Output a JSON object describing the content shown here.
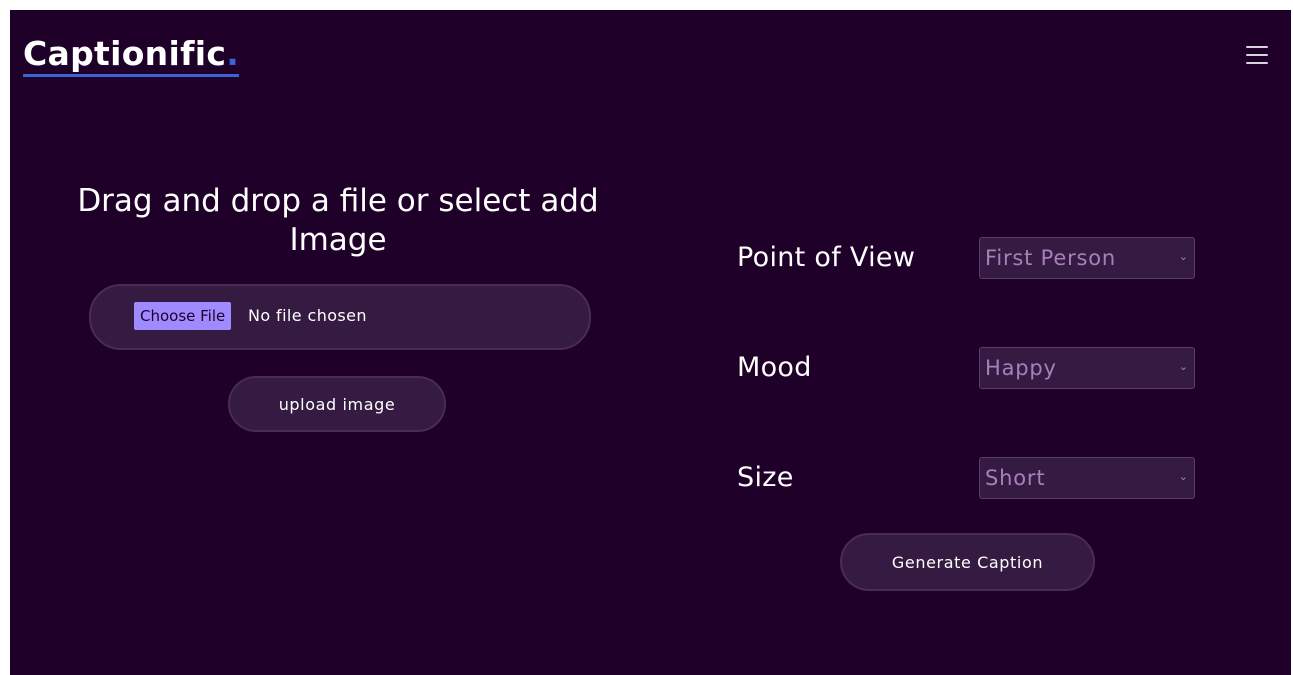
{
  "header": {
    "logo_text": "Captionific",
    "logo_dot": ".",
    "menu_icon": "hamburger-menu-icon"
  },
  "upload": {
    "title": "Drag and drop a file or select add Image",
    "choose_file_label": "Choose File",
    "file_status": "No file chosen",
    "upload_button_label": "upload image"
  },
  "options": {
    "point_of_view": {
      "label": "Point of View",
      "selected": "First Person"
    },
    "mood": {
      "label": "Mood",
      "selected": "Happy"
    },
    "size": {
      "label": "Size",
      "selected": "Short"
    },
    "chevron_glyph": "⌄"
  },
  "actions": {
    "generate_label": "Generate Caption"
  },
  "colors": {
    "background": "#1e0028",
    "surface": "#351b41",
    "accent": "#9f8bff",
    "logo_underline": "#3b63d6",
    "select_text": "#a780b8"
  }
}
